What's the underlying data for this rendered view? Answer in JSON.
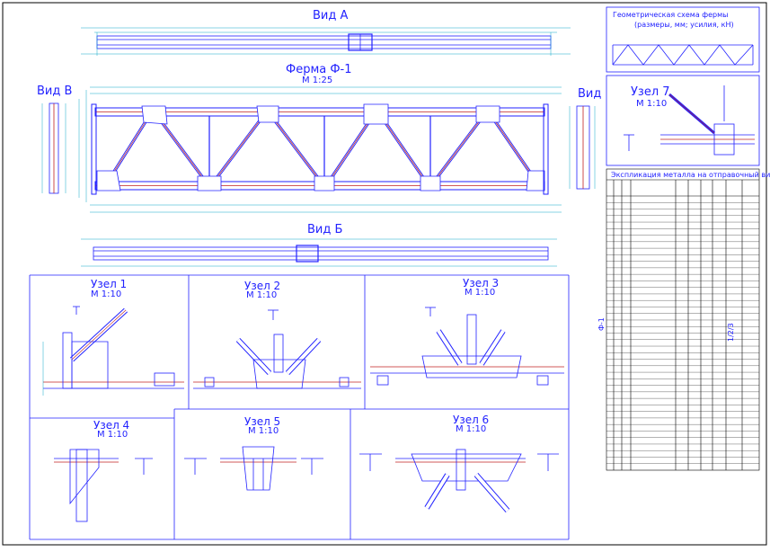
{
  "views": {
    "view_a": "Вид А",
    "view_b": "Вид Б",
    "view_v": "Вид В",
    "view_side": "Вид"
  },
  "truss": {
    "title": "Ферма Ф-1",
    "scale": "М 1:25"
  },
  "scheme": {
    "line1": "Геометрическая схема фермы",
    "line2": "(размеры, мм; усилия, кН)"
  },
  "nodes": [
    {
      "title": "Узел 1",
      "scale": "М 1:10"
    },
    {
      "title": "Узел 2",
      "scale": "М 1:10"
    },
    {
      "title": "Узел 3",
      "scale": "М 1:10"
    },
    {
      "title": "Узел 4",
      "scale": "М 1:10"
    },
    {
      "title": "Узел 5",
      "scale": "М 1:10"
    },
    {
      "title": "Узел 6",
      "scale": "М 1:10"
    },
    {
      "title": "Узел 7",
      "scale": "М 1:10"
    }
  ],
  "spec": {
    "title": "Экспликация металла на отправочный вид",
    "side_label": "Ф-1",
    "merged_label": "1/2/3",
    "rows": 42
  },
  "colors": {
    "line": "#2222ff",
    "dim": "#10a8c8",
    "member": "#c02020",
    "frame": "#000000"
  }
}
